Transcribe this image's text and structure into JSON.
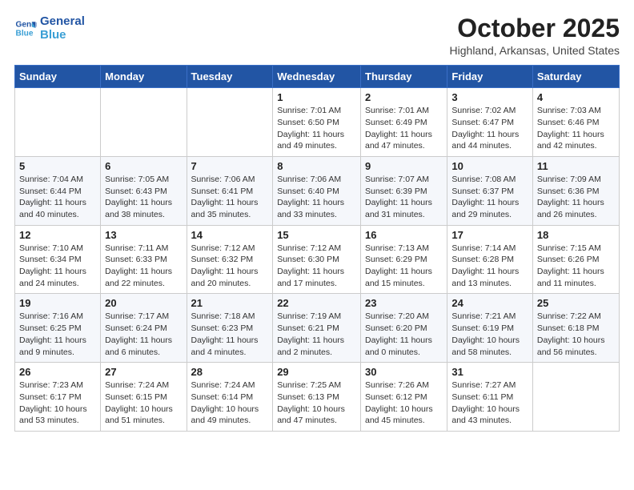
{
  "header": {
    "logo_line1": "General",
    "logo_line2": "Blue",
    "month": "October 2025",
    "location": "Highland, Arkansas, United States"
  },
  "weekdays": [
    "Sunday",
    "Monday",
    "Tuesday",
    "Wednesday",
    "Thursday",
    "Friday",
    "Saturday"
  ],
  "weeks": [
    [
      {
        "day": "",
        "info": ""
      },
      {
        "day": "",
        "info": ""
      },
      {
        "day": "",
        "info": ""
      },
      {
        "day": "1",
        "info": "Sunrise: 7:01 AM\nSunset: 6:50 PM\nDaylight: 11 hours\nand 49 minutes."
      },
      {
        "day": "2",
        "info": "Sunrise: 7:01 AM\nSunset: 6:49 PM\nDaylight: 11 hours\nand 47 minutes."
      },
      {
        "day": "3",
        "info": "Sunrise: 7:02 AM\nSunset: 6:47 PM\nDaylight: 11 hours\nand 44 minutes."
      },
      {
        "day": "4",
        "info": "Sunrise: 7:03 AM\nSunset: 6:46 PM\nDaylight: 11 hours\nand 42 minutes."
      }
    ],
    [
      {
        "day": "5",
        "info": "Sunrise: 7:04 AM\nSunset: 6:44 PM\nDaylight: 11 hours\nand 40 minutes."
      },
      {
        "day": "6",
        "info": "Sunrise: 7:05 AM\nSunset: 6:43 PM\nDaylight: 11 hours\nand 38 minutes."
      },
      {
        "day": "7",
        "info": "Sunrise: 7:06 AM\nSunset: 6:41 PM\nDaylight: 11 hours\nand 35 minutes."
      },
      {
        "day": "8",
        "info": "Sunrise: 7:06 AM\nSunset: 6:40 PM\nDaylight: 11 hours\nand 33 minutes."
      },
      {
        "day": "9",
        "info": "Sunrise: 7:07 AM\nSunset: 6:39 PM\nDaylight: 11 hours\nand 31 minutes."
      },
      {
        "day": "10",
        "info": "Sunrise: 7:08 AM\nSunset: 6:37 PM\nDaylight: 11 hours\nand 29 minutes."
      },
      {
        "day": "11",
        "info": "Sunrise: 7:09 AM\nSunset: 6:36 PM\nDaylight: 11 hours\nand 26 minutes."
      }
    ],
    [
      {
        "day": "12",
        "info": "Sunrise: 7:10 AM\nSunset: 6:34 PM\nDaylight: 11 hours\nand 24 minutes."
      },
      {
        "day": "13",
        "info": "Sunrise: 7:11 AM\nSunset: 6:33 PM\nDaylight: 11 hours\nand 22 minutes."
      },
      {
        "day": "14",
        "info": "Sunrise: 7:12 AM\nSunset: 6:32 PM\nDaylight: 11 hours\nand 20 minutes."
      },
      {
        "day": "15",
        "info": "Sunrise: 7:12 AM\nSunset: 6:30 PM\nDaylight: 11 hours\nand 17 minutes."
      },
      {
        "day": "16",
        "info": "Sunrise: 7:13 AM\nSunset: 6:29 PM\nDaylight: 11 hours\nand 15 minutes."
      },
      {
        "day": "17",
        "info": "Sunrise: 7:14 AM\nSunset: 6:28 PM\nDaylight: 11 hours\nand 13 minutes."
      },
      {
        "day": "18",
        "info": "Sunrise: 7:15 AM\nSunset: 6:26 PM\nDaylight: 11 hours\nand 11 minutes."
      }
    ],
    [
      {
        "day": "19",
        "info": "Sunrise: 7:16 AM\nSunset: 6:25 PM\nDaylight: 11 hours\nand 9 minutes."
      },
      {
        "day": "20",
        "info": "Sunrise: 7:17 AM\nSunset: 6:24 PM\nDaylight: 11 hours\nand 6 minutes."
      },
      {
        "day": "21",
        "info": "Sunrise: 7:18 AM\nSunset: 6:23 PM\nDaylight: 11 hours\nand 4 minutes."
      },
      {
        "day": "22",
        "info": "Sunrise: 7:19 AM\nSunset: 6:21 PM\nDaylight: 11 hours\nand 2 minutes."
      },
      {
        "day": "23",
        "info": "Sunrise: 7:20 AM\nSunset: 6:20 PM\nDaylight: 11 hours\nand 0 minutes."
      },
      {
        "day": "24",
        "info": "Sunrise: 7:21 AM\nSunset: 6:19 PM\nDaylight: 10 hours\nand 58 minutes."
      },
      {
        "day": "25",
        "info": "Sunrise: 7:22 AM\nSunset: 6:18 PM\nDaylight: 10 hours\nand 56 minutes."
      }
    ],
    [
      {
        "day": "26",
        "info": "Sunrise: 7:23 AM\nSunset: 6:17 PM\nDaylight: 10 hours\nand 53 minutes."
      },
      {
        "day": "27",
        "info": "Sunrise: 7:24 AM\nSunset: 6:15 PM\nDaylight: 10 hours\nand 51 minutes."
      },
      {
        "day": "28",
        "info": "Sunrise: 7:24 AM\nSunset: 6:14 PM\nDaylight: 10 hours\nand 49 minutes."
      },
      {
        "day": "29",
        "info": "Sunrise: 7:25 AM\nSunset: 6:13 PM\nDaylight: 10 hours\nand 47 minutes."
      },
      {
        "day": "30",
        "info": "Sunrise: 7:26 AM\nSunset: 6:12 PM\nDaylight: 10 hours\nand 45 minutes."
      },
      {
        "day": "31",
        "info": "Sunrise: 7:27 AM\nSunset: 6:11 PM\nDaylight: 10 hours\nand 43 minutes."
      },
      {
        "day": "",
        "info": ""
      }
    ]
  ]
}
